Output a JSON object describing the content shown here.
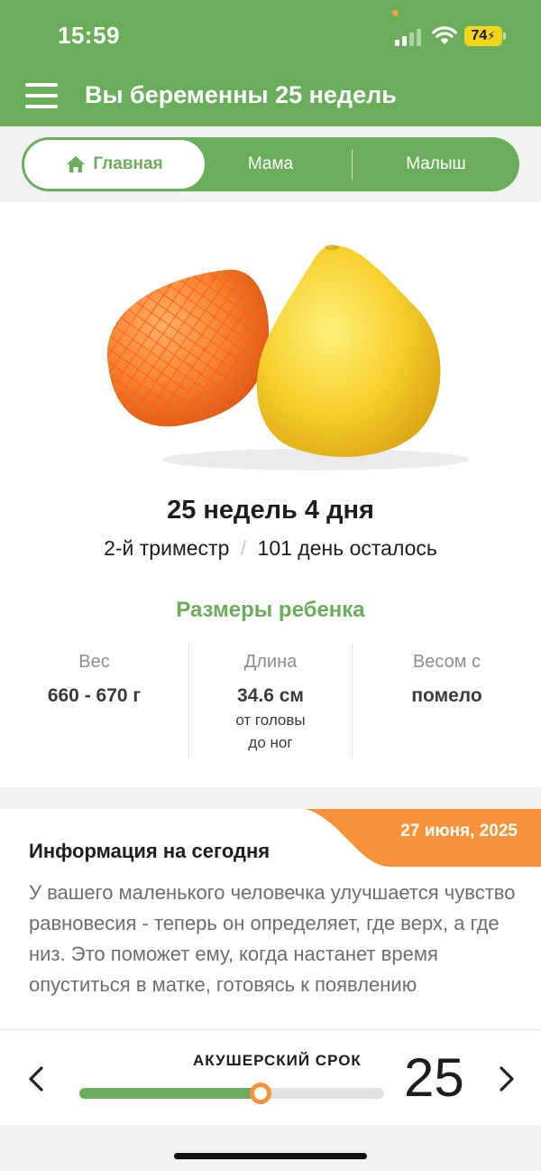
{
  "status_bar": {
    "time": "15:59",
    "battery": "74"
  },
  "header": {
    "title": "Вы беременны 25 недель"
  },
  "tabs": [
    {
      "label": "Главная",
      "active": true
    },
    {
      "label": "Мама",
      "active": false
    },
    {
      "label": "Малыш",
      "active": false
    }
  ],
  "week_summary": {
    "title": "25 недель 4 дня",
    "trimester": "2-й триместр",
    "separator": "/",
    "days_left": "101 день осталось"
  },
  "baby_sizes": {
    "title": "Размеры ребенка",
    "weight": {
      "label": "Вес",
      "value": "660 - 670 г"
    },
    "length": {
      "label": "Длина",
      "value": "34.6 см",
      "note_line1": "от головы",
      "note_line2": "до ног"
    },
    "fruit": {
      "label": "Весом с",
      "value": "помело"
    }
  },
  "today_info": {
    "date": "27 июня, 2025",
    "title": "Информация на сегодня",
    "text": "У вашего маленького человечка улучшается чувство равновесия - теперь он определяет, где верх, а где низ. Это поможет ему, когда настанет время опуститься в матке, готовясь к появлению"
  },
  "term_selector": {
    "label": "АКУШЕРСКИЙ СРОК",
    "week": "25",
    "progress_fraction": 0.595
  },
  "colors": {
    "accent_green": "#6aae5b",
    "accent_orange": "#f7943b"
  },
  "icons": [
    "menu-icon",
    "home-icon",
    "chevron-left-icon",
    "chevron-right-icon",
    "wifi-icon",
    "signal-icon"
  ]
}
